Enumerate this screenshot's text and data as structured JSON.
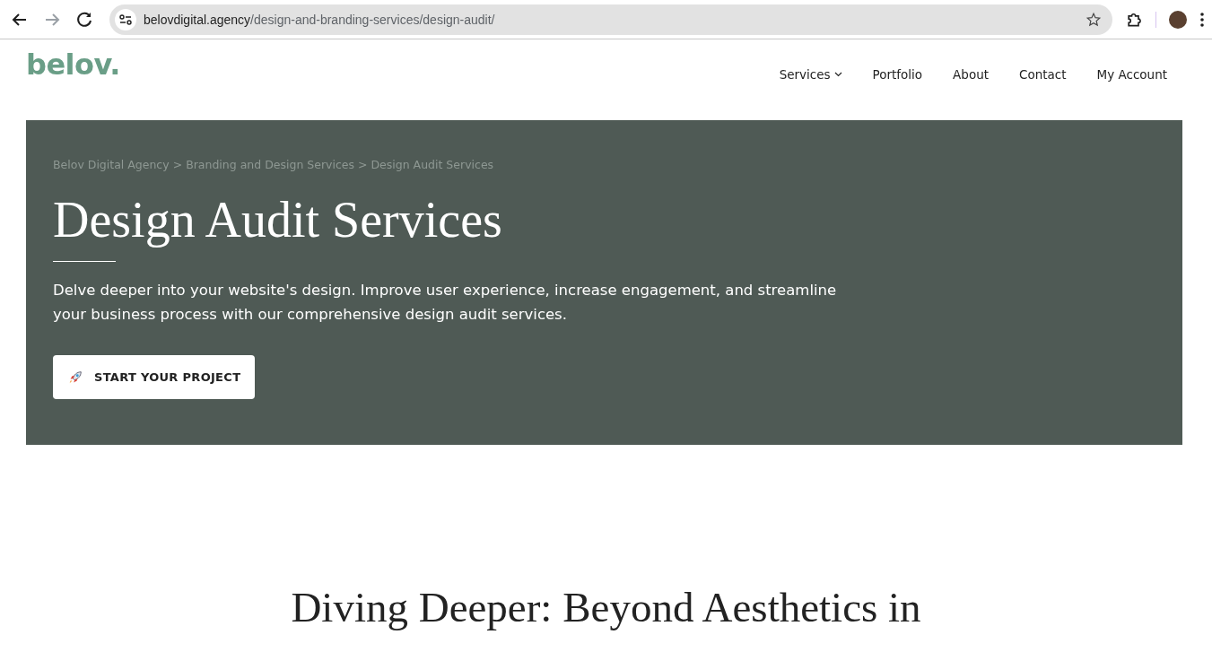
{
  "browser": {
    "url": {
      "host": "belovdigital.agency",
      "path": "/design-and-branding-services/design-audit/"
    },
    "forward_disabled": true
  },
  "header": {
    "logo": "belov.",
    "nav": [
      {
        "label": "Services",
        "has_dropdown": true
      },
      {
        "label": "Portfolio",
        "has_dropdown": false
      },
      {
        "label": "About",
        "has_dropdown": false
      },
      {
        "label": "Contact",
        "has_dropdown": false
      },
      {
        "label": "My Account",
        "has_dropdown": false
      }
    ]
  },
  "hero": {
    "breadcrumb": [
      {
        "label": "Belov Digital Agency",
        "separator": ">"
      },
      {
        "label": "Branding and Design Services",
        "separator": ">"
      },
      {
        "label": "Design Audit Services"
      }
    ],
    "title": "Design Audit Services",
    "description": "Delve deeper into your website's design. Improve user experience, increase engagement, and streamline your business process with our comprehensive design audit services.",
    "button": "START YOUR PROJECT"
  },
  "section": {
    "heading": "Diving Deeper: Beyond Aesthetics in"
  }
}
